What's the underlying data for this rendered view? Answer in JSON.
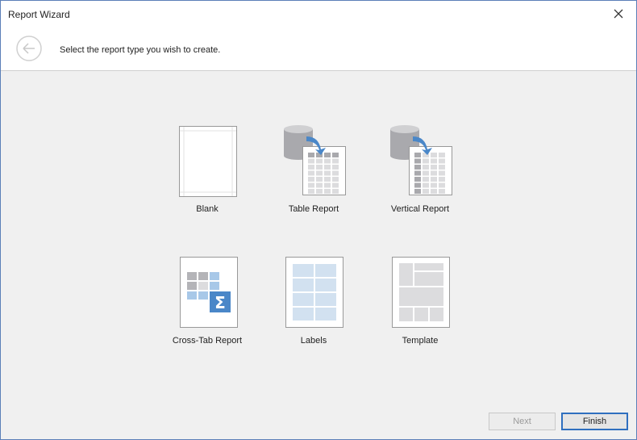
{
  "window": {
    "title": "Report Wizard"
  },
  "header": {
    "prompt": "Select the report type you wish to create."
  },
  "tiles": [
    {
      "label": "Blank"
    },
    {
      "label": "Table Report"
    },
    {
      "label": "Vertical Report"
    },
    {
      "label": "Cross-Tab Report"
    },
    {
      "label": "Labels"
    },
    {
      "label": "Template"
    }
  ],
  "footer": {
    "next": "Next",
    "finish": "Finish"
  },
  "colors": {
    "accent": "#4a87c8",
    "border": "#5b7fb8"
  }
}
